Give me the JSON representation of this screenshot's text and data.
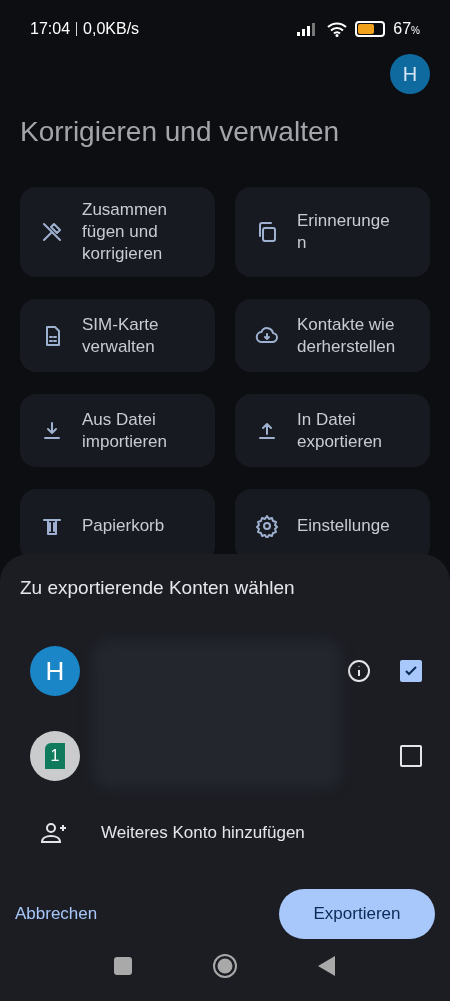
{
  "status_bar": {
    "time": "17:04",
    "speed": "0,0KB/s",
    "battery_text": "67",
    "battery_unit": "%",
    "battery": {
      "level": 0.67
    }
  },
  "profile_avatar": {
    "letter": "H"
  },
  "title": "Korrigieren und verwalten",
  "tiles": [
    {
      "kind": "merge",
      "label": "Zusammen fügen und korrigieren"
    },
    {
      "kind": "reminders",
      "label": "Erinnerunge n"
    },
    {
      "kind": "sim",
      "label": "SIM-Karte verwalten"
    },
    {
      "kind": "restore",
      "label": "Kontakte wie derherstellen"
    },
    {
      "kind": "import",
      "label": "Aus Datei importieren"
    },
    {
      "kind": "export",
      "label": "In Datei exportieren"
    },
    {
      "kind": "trash",
      "label": "Papierkorb"
    },
    {
      "kind": "settings",
      "label": "Einstellunge"
    }
  ],
  "sheet": {
    "title": "Zu exportierende Konten wählen",
    "accounts": [
      {
        "kind": "letter",
        "letter": "H",
        "info": true,
        "checked": true
      },
      {
        "kind": "sim",
        "letter": "1",
        "info": false,
        "checked": false
      }
    ],
    "add_account": "Weiteres Konto hinzufügen",
    "cancel": "Abbrechen",
    "confirm": "Exportieren"
  }
}
